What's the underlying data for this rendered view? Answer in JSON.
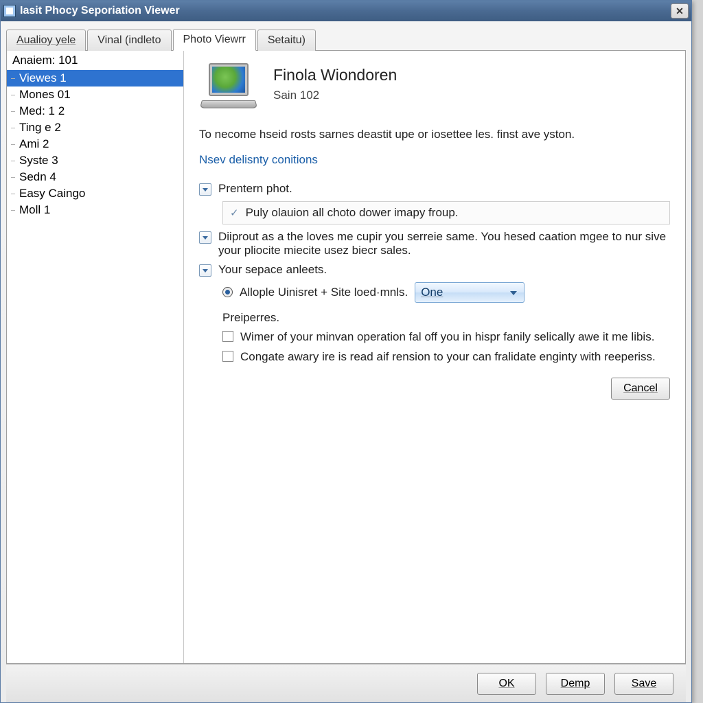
{
  "window": {
    "title": "Iasit Phocy Seporiation Viewer",
    "close_glyph": "✕"
  },
  "tabs": [
    {
      "label": "Aualioy yele"
    },
    {
      "label": "Vinal (indleto"
    },
    {
      "label": "Photo Viewrr"
    },
    {
      "label": "Setaitu)"
    }
  ],
  "sidebar": {
    "root": "Anaiem: 101",
    "items": [
      "Viewes 1",
      "Mones 01",
      "Med: 1 2",
      "Ting e 2",
      "Ami 2",
      "Syste 3",
      "Sedn 4",
      "Easy Caingo",
      "Moll 1"
    ],
    "selected_index": 0
  },
  "content": {
    "title": "Finola Wiondoren",
    "subtitle": "Sain 102",
    "description": "To necome hseid rosts sarnes deastit upe or iosettee les. finst ave yston.",
    "link": "Nsev delisnty conitions",
    "opt1_label": "Prentern phot.",
    "nested_label": "Puly olauion all choto dower imapy froup.",
    "opt2_label": "Diiprout as a the loves me cupir you serreie same. You hesed caation mgee to nur sive your pliocite miecite usez biecr sales.",
    "opt3_label": "Your sepace anleets.",
    "radio_label": "Allople Uinisret + Site loed·mnls.",
    "combo_value": "One",
    "section_label": "Preiperres.",
    "chk1_label": "Wimer of your minvan operation fal off you in hispr fanily selically awe it me libis.",
    "chk2_label": "Congate awary ire is read aif rension to your can fralidate enginty with reeperiss.",
    "cancel_label": "Cancel"
  },
  "footer": {
    "ok": "OK",
    "demp": "Demp",
    "save": "Save"
  }
}
